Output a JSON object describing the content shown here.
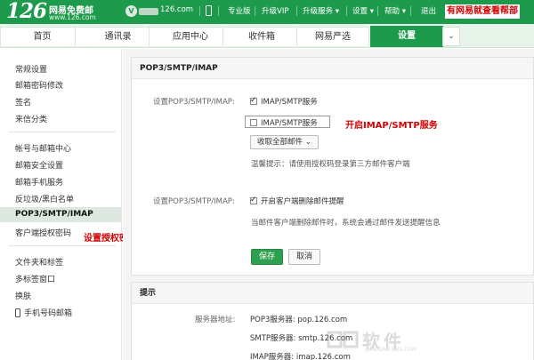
{
  "brand": {
    "number": "126",
    "name": "网易免费邮",
    "url": "www.126.com"
  },
  "account": {
    "avatar_letter": "V",
    "domain_suffix": "126.com"
  },
  "topnav": {
    "pro": "专业版",
    "vip": "升级VIP",
    "upgrade": "升级服务 ▾",
    "settings": "设置 ▾",
    "help": "帮助 ▾",
    "logout": "退出"
  },
  "callouts": {
    "top": "有网易就查看帮部",
    "imap": "开启IMAP/SMTP服务",
    "auth": "设置授权密码"
  },
  "tabs": [
    {
      "label": "首页"
    },
    {
      "label": "通讯录"
    },
    {
      "label": "应用中心"
    },
    {
      "label": "收件箱"
    },
    {
      "label": "网易严选"
    },
    {
      "label": "设置"
    }
  ],
  "tabs_more": "⌄",
  "sidebar": {
    "items": [
      {
        "label": "常规设置"
      },
      {
        "label": "邮箱密码修改"
      },
      {
        "label": "签名"
      },
      {
        "label": "来信分类"
      },
      {
        "label": "帐号与邮箱中心"
      },
      {
        "label": "邮箱安全设置"
      },
      {
        "label": "邮箱手机服务"
      },
      {
        "label": "反垃圾/黑白名单"
      },
      {
        "label": "POP3/SMTP/IMAP"
      },
      {
        "label": "客户端授权密码"
      },
      {
        "label": "文件夹和标签"
      },
      {
        "label": "多标签窗口"
      },
      {
        "label": "换肤"
      },
      {
        "label": "手机号码邮箱"
      }
    ]
  },
  "main": {
    "section1": {
      "title": "POP3/SMTP/IMAP",
      "label1": "设置POP3/SMTP/IMAP:",
      "options": [
        {
          "label": "IMAP/SMTP服务",
          "checked": true
        },
        {
          "label": "IMAP/SMTP服务",
          "checked": false
        }
      ],
      "select": "收取全部邮件 ⌄",
      "hint1": "温馨提示：请使用授权码登录第三方邮件客户端",
      "label2": "设置POP3/SMTP/IMAP:",
      "option3": {
        "label": "开启客户端删除邮件提醒",
        "checked": true
      },
      "hint2": "当邮件客户端删除邮件时，系统会通过邮件发送提醒信息",
      "save": "保存",
      "cancel": "取消"
    },
    "section2": {
      "title": "提示",
      "server_label": "服务器地址:",
      "pop": "POP3服务器: pop.126.com",
      "smtp": "SMTP服务器: smtp.126.com",
      "imap": "IMAP服务器: imap.126.com"
    }
  },
  "watermark": {
    "text": "软件",
    "sub": "JIAN DAN BBS.COM"
  },
  "colors": {
    "brand_green": "#1d9a4c",
    "callout_red": "#d40000",
    "save_green": "#2e9f4e"
  }
}
